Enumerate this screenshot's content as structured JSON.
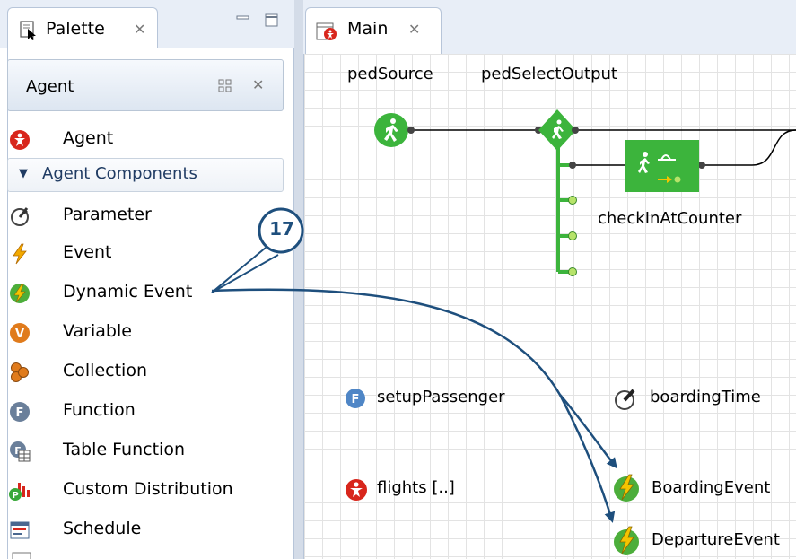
{
  "palette": {
    "tab_title": "Palette",
    "drawer_title": "Agent",
    "items_top": [
      {
        "label": "Agent",
        "icon": "agent-icon"
      }
    ],
    "section_title": "Agent Components",
    "items": [
      {
        "label": "Parameter",
        "icon": "parameter-icon"
      },
      {
        "label": "Event",
        "icon": "event-icon"
      },
      {
        "label": "Dynamic Event",
        "icon": "dynamic-event-icon"
      },
      {
        "label": "Variable",
        "icon": "variable-icon"
      },
      {
        "label": "Collection",
        "icon": "collection-icon"
      },
      {
        "label": "Function",
        "icon": "function-icon"
      },
      {
        "label": "Table Function",
        "icon": "table-function-icon"
      },
      {
        "label": "Custom Distribution",
        "icon": "custom-distribution-icon"
      },
      {
        "label": "Schedule",
        "icon": "schedule-icon"
      }
    ]
  },
  "editor": {
    "tab_title": "Main",
    "blocks": {
      "ped_source": "pedSource",
      "ped_select_output": "pedSelectOutput",
      "check_in": "checkInAtCounter"
    },
    "elements": {
      "setup_passenger": "setupPassenger",
      "boarding_time": "boardingTime",
      "flights": "flights [..]",
      "boarding_event": "BoardingEvent",
      "departure_event": "DepartureEvent"
    }
  },
  "callout": {
    "number": "17"
  },
  "colors": {
    "flow_green": "#3cb43c",
    "agent_red": "#d8261c",
    "function_blue": "#4f86c6",
    "callout_blue": "#1e4f7d"
  }
}
